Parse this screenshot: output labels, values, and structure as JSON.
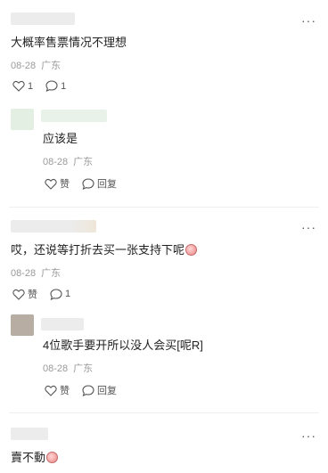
{
  "comments": [
    {
      "text": "大概率售票情况不理想",
      "date": "08-28",
      "location": "广东",
      "like_count": "1",
      "reply_count": "1",
      "more_icon": "more-dots-icon"
    },
    {
      "text": "应该是",
      "date": "08-28",
      "location": "广东",
      "like_label": "赞",
      "reply_label": "回复"
    },
    {
      "text": "哎，还说等打折去买一张支持下呢",
      "date": "08-28",
      "location": "广东",
      "like_label": "赞",
      "reply_count": "1"
    },
    {
      "text": "4位歌手要开所以没人会买[呢R]",
      "date": "08-28",
      "location": "广东",
      "like_label": "赞",
      "reply_label": "回复"
    },
    {
      "text": "賣不動"
    }
  ],
  "more_glyph": "···"
}
